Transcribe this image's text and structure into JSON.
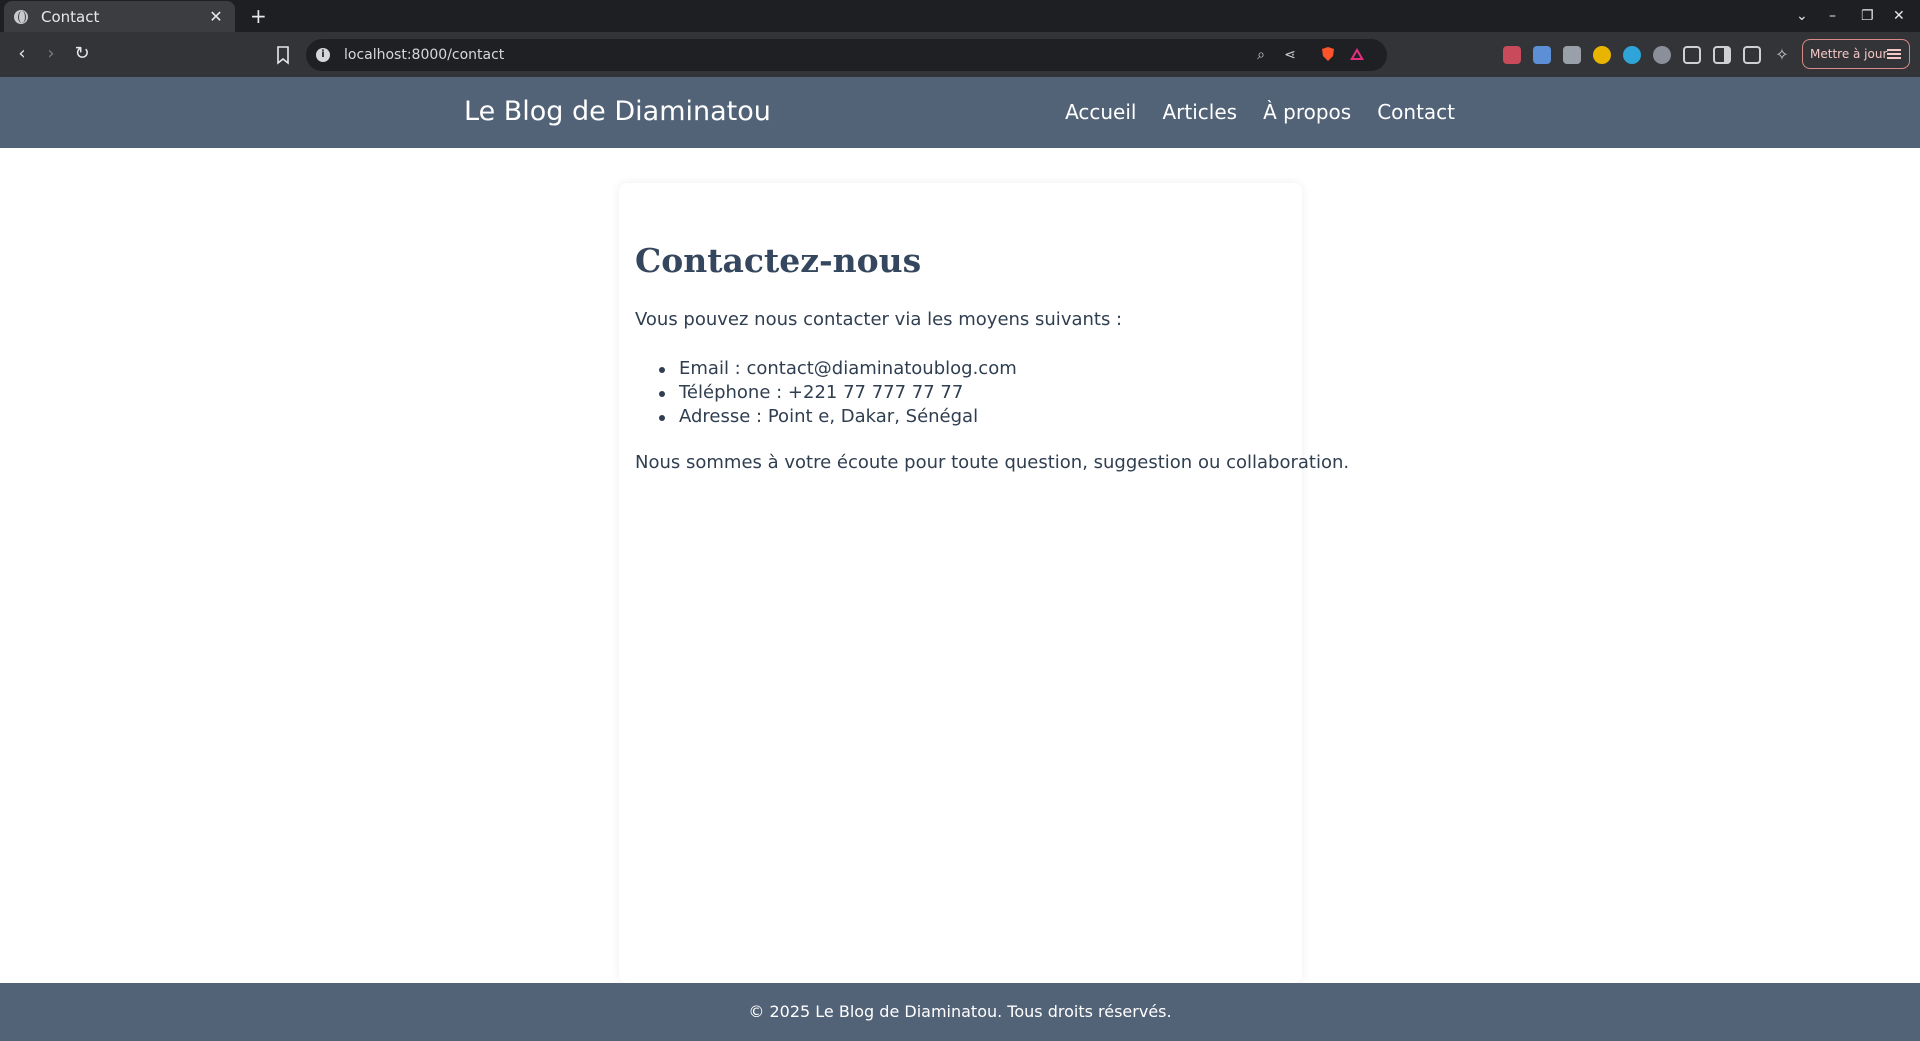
{
  "browser": {
    "tab_title": "Contact",
    "tab_close": "✕",
    "new_tab": "+",
    "url": "localhost:8000/contact",
    "update_button": "Mettre à jour"
  },
  "header": {
    "brand": "Le Blog de Diaminatou",
    "nav": [
      "Accueil",
      "Articles",
      "À propos",
      "Contact"
    ]
  },
  "main": {
    "title": "Contactez-nous",
    "intro": "Vous pouvez nous contacter via les moyens suivants :",
    "items": [
      "Email : contact@diaminatoublog.com",
      "Téléphone : +221 77 777 77 77",
      "Adresse : Point e, Dakar, Sénégal"
    ],
    "outro": "Nous sommes à votre écoute pour toute question, suggestion ou collaboration."
  },
  "footer": {
    "text": "© 2025 Le Blog de Diaminatou. Tous droits réservés."
  },
  "colors": {
    "header_bg": "#526277",
    "heading": "#34475e",
    "text": "#2f3e50"
  }
}
